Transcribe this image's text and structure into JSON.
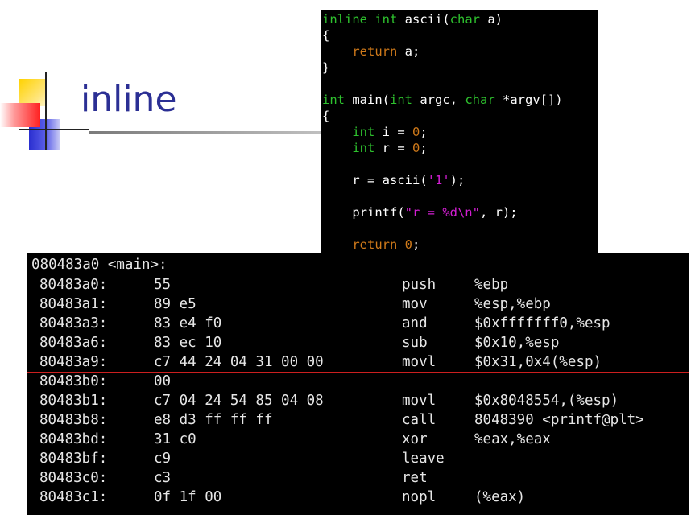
{
  "slide": {
    "title": "inline"
  },
  "source_code": {
    "lines": [
      {
        "p1": "inline int",
        "p2": " ascii(",
        "p3": "char",
        "p4": " a)"
      },
      {
        "text": "{"
      },
      {
        "indent": "    ",
        "kw": "return",
        "rest": " a;"
      },
      {
        "text": "}"
      },
      {
        "text": ""
      },
      {
        "p1": "int",
        "p2": " main(",
        "p3": "int",
        "p4": " argc, ",
        "p5": "char",
        "p6": " *argv[])"
      },
      {
        "text": "{"
      },
      {
        "indent": "    ",
        "kw": "int",
        "rest": " i = ",
        "num": "0",
        "end": ";"
      },
      {
        "indent": "    ",
        "kw": "int",
        "rest": " r = ",
        "num": "0",
        "end": ";"
      },
      {
        "text": ""
      },
      {
        "pre": "    r = ascii(",
        "str": "'1'",
        "post": ");"
      },
      {
        "text": ""
      },
      {
        "pre": "    printf(",
        "str": "\"r = %d\\n\"",
        "post": ", r);"
      },
      {
        "text": ""
      },
      {
        "indent": "    ",
        "kw": "return",
        "rest": " ",
        "num": "0",
        "end": ";"
      }
    ]
  },
  "disassembly": {
    "header": "080483a0 <main>:",
    "rows": [
      {
        "addr": "80483a0:",
        "bytes": "55",
        "mnemonic": "push",
        "operands": "%ebp"
      },
      {
        "addr": "80483a1:",
        "bytes": "89 e5",
        "mnemonic": "mov",
        "operands": "%esp,%ebp"
      },
      {
        "addr": "80483a3:",
        "bytes": "83 e4 f0",
        "mnemonic": "and",
        "operands": "$0xfffffff0,%esp"
      },
      {
        "addr": "80483a6:",
        "bytes": "83 ec 10",
        "mnemonic": "sub",
        "operands": "$0x10,%esp"
      },
      {
        "addr": "80483a9:",
        "bytes": "c7 44 24 04 31 00 00",
        "mnemonic": "movl",
        "operands": "$0x31,0x4(%esp)"
      },
      {
        "addr": "80483b0:",
        "bytes": "00",
        "mnemonic": "",
        "operands": ""
      },
      {
        "addr": "80483b1:",
        "bytes": "c7 04 24 54 85 04 08",
        "mnemonic": "movl",
        "operands": "$0x8048554,(%esp)"
      },
      {
        "addr": "80483b8:",
        "bytes": "e8 d3 ff ff ff",
        "mnemonic": "call",
        "operands": "8048390 <printf@plt>"
      },
      {
        "addr": "80483bd:",
        "bytes": "31 c0",
        "mnemonic": "xor",
        "operands": "%eax,%eax"
      },
      {
        "addr": "80483bf:",
        "bytes": "c9",
        "mnemonic": "leave",
        "operands": ""
      },
      {
        "addr": "80483c0:",
        "bytes": "c3",
        "mnemonic": "ret",
        "operands": ""
      },
      {
        "addr": "80483c1:",
        "bytes": "0f 1f 00",
        "mnemonic": "nopl",
        "operands": "(%eax)"
      }
    ],
    "highlight_color": "#cc1f1f"
  },
  "colors": {
    "title": "#2b2f94",
    "keyword": "#2ec22e",
    "number_return": "#d07a1a",
    "string": "#d21ed2"
  }
}
